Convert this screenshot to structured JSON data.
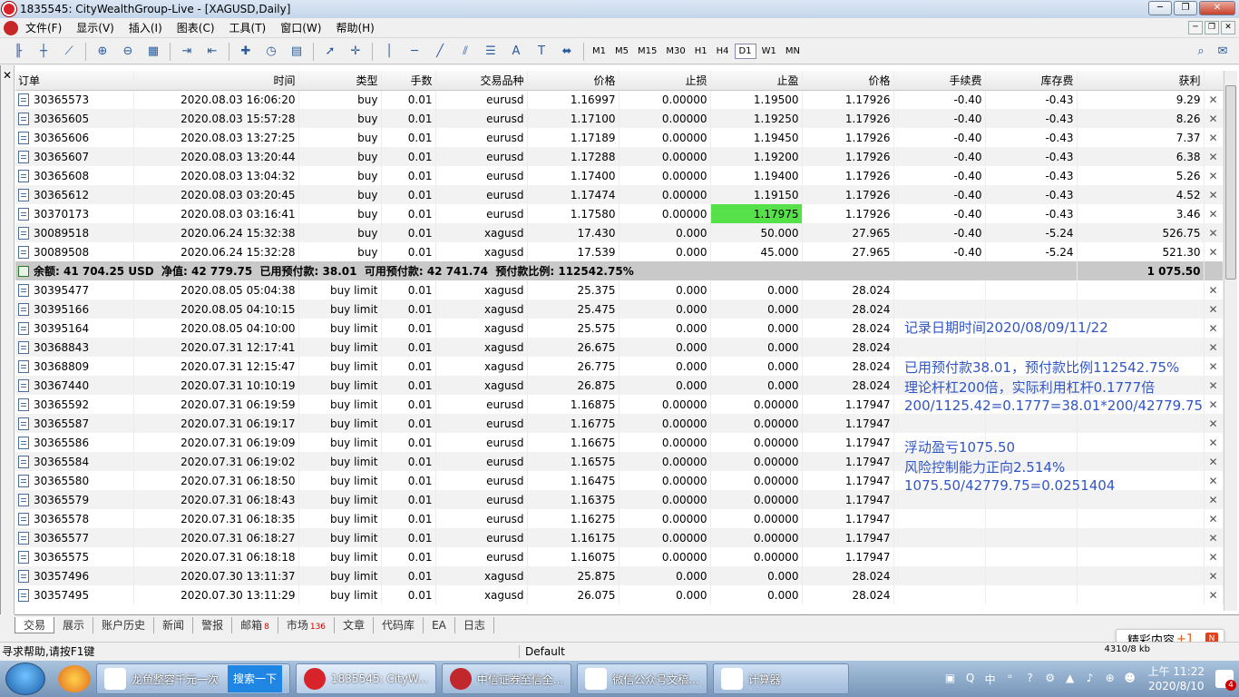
{
  "window": {
    "title": "1835545: CityWealthGroup-Live - [XAGUSD,Daily]"
  },
  "menu": [
    "文件(F)",
    "显示(V)",
    "插入(I)",
    "图表(C)",
    "工具(T)",
    "窗口(W)",
    "帮助(H)"
  ],
  "toolbar": {
    "timeframes": [
      "M1",
      "M5",
      "M15",
      "M30",
      "H1",
      "H4",
      "D1",
      "W1",
      "MN"
    ],
    "active_timeframe": "D1"
  },
  "columns": [
    "订单",
    "时间",
    "类型",
    "手数",
    "交易品种",
    "价格",
    "止损",
    "止盈",
    "价格",
    "手续费",
    "库存费",
    "获利"
  ],
  "positions": [
    {
      "order": "30365573",
      "time": "2020.08.03 16:06:20",
      "type": "buy",
      "lots": "0.01",
      "symbol": "eurusd",
      "price": "1.16997",
      "sl": "0.00000",
      "tp": "1.19500",
      "cur": "1.17926",
      "commission": "-0.40",
      "swap": "-0.43",
      "profit": "9.29"
    },
    {
      "order": "30365605",
      "time": "2020.08.03 15:57:28",
      "type": "buy",
      "lots": "0.01",
      "symbol": "eurusd",
      "price": "1.17100",
      "sl": "0.00000",
      "tp": "1.19250",
      "cur": "1.17926",
      "commission": "-0.40",
      "swap": "-0.43",
      "profit": "8.26"
    },
    {
      "order": "30365606",
      "time": "2020.08.03 13:27:25",
      "type": "buy",
      "lots": "0.01",
      "symbol": "eurusd",
      "price": "1.17189",
      "sl": "0.00000",
      "tp": "1.19450",
      "cur": "1.17926",
      "commission": "-0.40",
      "swap": "-0.43",
      "profit": "7.37"
    },
    {
      "order": "30365607",
      "time": "2020.08.03 13:20:44",
      "type": "buy",
      "lots": "0.01",
      "symbol": "eurusd",
      "price": "1.17288",
      "sl": "0.00000",
      "tp": "1.19200",
      "cur": "1.17926",
      "commission": "-0.40",
      "swap": "-0.43",
      "profit": "6.38"
    },
    {
      "order": "30365608",
      "time": "2020.08.03 13:04:32",
      "type": "buy",
      "lots": "0.01",
      "symbol": "eurusd",
      "price": "1.17400",
      "sl": "0.00000",
      "tp": "1.19400",
      "cur": "1.17926",
      "commission": "-0.40",
      "swap": "-0.43",
      "profit": "5.26"
    },
    {
      "order": "30365612",
      "time": "2020.08.03 03:20:45",
      "type": "buy",
      "lots": "0.01",
      "symbol": "eurusd",
      "price": "1.17474",
      "sl": "0.00000",
      "tp": "1.19150",
      "cur": "1.17926",
      "commission": "-0.40",
      "swap": "-0.43",
      "profit": "4.52"
    },
    {
      "order": "30370173",
      "time": "2020.08.03 03:16:41",
      "type": "buy",
      "lots": "0.01",
      "symbol": "eurusd",
      "price": "1.17580",
      "sl": "0.00000",
      "tp": "1.17975",
      "cur": "1.17926",
      "commission": "-0.40",
      "swap": "-0.43",
      "profit": "3.46",
      "tp_highlight": true
    },
    {
      "order": "30089518",
      "time": "2020.06.24 15:32:38",
      "type": "buy",
      "lots": "0.01",
      "symbol": "xagusd",
      "price": "17.430",
      "sl": "0.000",
      "tp": "50.000",
      "cur": "27.965",
      "commission": "-0.40",
      "swap": "-5.24",
      "profit": "526.75"
    },
    {
      "order": "30089508",
      "time": "2020.06.24 15:32:28",
      "type": "buy",
      "lots": "0.01",
      "symbol": "xagusd",
      "price": "17.539",
      "sl": "0.000",
      "tp": "45.000",
      "cur": "27.965",
      "commission": "-0.40",
      "swap": "-5.24",
      "profit": "521.30"
    }
  ],
  "summary": {
    "text": "余额: 41 704.25 USD  净值: 42 779.75  已用预付款: 38.01  可用预付款: 42 741.74  预付款比例: 112542.75%",
    "profit": "1 075.50"
  },
  "pending": [
    {
      "order": "30395477",
      "time": "2020.08.05 05:04:38",
      "type": "buy limit",
      "lots": "0.01",
      "symbol": "xagusd",
      "price": "25.375",
      "sl": "0.000",
      "tp": "0.000",
      "cur": "28.024"
    },
    {
      "order": "30395166",
      "time": "2020.08.05 04:10:15",
      "type": "buy limit",
      "lots": "0.01",
      "symbol": "xagusd",
      "price": "25.475",
      "sl": "0.000",
      "tp": "0.000",
      "cur": "28.024"
    },
    {
      "order": "30395164",
      "time": "2020.08.05 04:10:00",
      "type": "buy limit",
      "lots": "0.01",
      "symbol": "xagusd",
      "price": "25.575",
      "sl": "0.000",
      "tp": "0.000",
      "cur": "28.024"
    },
    {
      "order": "30368843",
      "time": "2020.07.31 12:17:41",
      "type": "buy limit",
      "lots": "0.01",
      "symbol": "xagusd",
      "price": "26.675",
      "sl": "0.000",
      "tp": "0.000",
      "cur": "28.024"
    },
    {
      "order": "30368809",
      "time": "2020.07.31 12:15:47",
      "type": "buy limit",
      "lots": "0.01",
      "symbol": "xagusd",
      "price": "26.775",
      "sl": "0.000",
      "tp": "0.000",
      "cur": "28.024"
    },
    {
      "order": "30367440",
      "time": "2020.07.31 10:10:19",
      "type": "buy limit",
      "lots": "0.01",
      "symbol": "xagusd",
      "price": "26.875",
      "sl": "0.000",
      "tp": "0.000",
      "cur": "28.024"
    },
    {
      "order": "30365592",
      "time": "2020.07.31 06:19:59",
      "type": "buy limit",
      "lots": "0.01",
      "symbol": "eurusd",
      "price": "1.16875",
      "sl": "0.00000",
      "tp": "0.00000",
      "cur": "1.17947"
    },
    {
      "order": "30365587",
      "time": "2020.07.31 06:19:17",
      "type": "buy limit",
      "lots": "0.01",
      "symbol": "eurusd",
      "price": "1.16775",
      "sl": "0.00000",
      "tp": "0.00000",
      "cur": "1.17947"
    },
    {
      "order": "30365586",
      "time": "2020.07.31 06:19:09",
      "type": "buy limit",
      "lots": "0.01",
      "symbol": "eurusd",
      "price": "1.16675",
      "sl": "0.00000",
      "tp": "0.00000",
      "cur": "1.17947"
    },
    {
      "order": "30365584",
      "time": "2020.07.31 06:19:02",
      "type": "buy limit",
      "lots": "0.01",
      "symbol": "eurusd",
      "price": "1.16575",
      "sl": "0.00000",
      "tp": "0.00000",
      "cur": "1.17947"
    },
    {
      "order": "30365580",
      "time": "2020.07.31 06:18:50",
      "type": "buy limit",
      "lots": "0.01",
      "symbol": "eurusd",
      "price": "1.16475",
      "sl": "0.00000",
      "tp": "0.00000",
      "cur": "1.17947"
    },
    {
      "order": "30365579",
      "time": "2020.07.31 06:18:43",
      "type": "buy limit",
      "lots": "0.01",
      "symbol": "eurusd",
      "price": "1.16375",
      "sl": "0.00000",
      "tp": "0.00000",
      "cur": "1.17947"
    },
    {
      "order": "30365578",
      "time": "2020.07.31 06:18:35",
      "type": "buy limit",
      "lots": "0.01",
      "symbol": "eurusd",
      "price": "1.16275",
      "sl": "0.00000",
      "tp": "0.00000",
      "cur": "1.17947"
    },
    {
      "order": "30365577",
      "time": "2020.07.31 06:18:27",
      "type": "buy limit",
      "lots": "0.01",
      "symbol": "eurusd",
      "price": "1.16175",
      "sl": "0.00000",
      "tp": "0.00000",
      "cur": "1.17947"
    },
    {
      "order": "30365575",
      "time": "2020.07.31 06:18:18",
      "type": "buy limit",
      "lots": "0.01",
      "symbol": "eurusd",
      "price": "1.16075",
      "sl": "0.00000",
      "tp": "0.00000",
      "cur": "1.17947"
    },
    {
      "order": "30357496",
      "time": "2020.07.30 13:11:37",
      "type": "buy limit",
      "lots": "0.01",
      "symbol": "xagusd",
      "price": "25.875",
      "sl": "0.000",
      "tp": "0.000",
      "cur": "28.024"
    },
    {
      "order": "30357495",
      "time": "2020.07.30 13:11:29",
      "type": "buy limit",
      "lots": "0.01",
      "symbol": "xagusd",
      "price": "26.075",
      "sl": "0.000",
      "tp": "0.000",
      "cur": "28.024"
    }
  ],
  "annotations": [
    "记录日期时间2020/08/09/11/22",
    "已用预付款38.01，预付款比例112542.75%",
    "理论杆杠200倍，实际利用杠杆0.1777倍",
    "200/1125.42=0.1777=38.01*200/42779.75",
    "浮动盈亏1075.50",
    "风险控制能力正向2.514%",
    "1075.50/42779.75=0.0251404"
  ],
  "tabs": [
    {
      "label": "交易",
      "active": true
    },
    {
      "label": "展示"
    },
    {
      "label": "账户历史"
    },
    {
      "label": "新闻"
    },
    {
      "label": "警报"
    },
    {
      "label": "邮箱",
      "badge": "8"
    },
    {
      "label": "市场",
      "badge": "136"
    },
    {
      "label": "文章"
    },
    {
      "label": "代码库"
    },
    {
      "label": "EA"
    },
    {
      "label": "日志"
    }
  ],
  "status": {
    "help": "寻求帮助,请按F1键",
    "profile": "Default",
    "traffic": "4310/8 kb"
  },
  "popup": {
    "label": "精彩内容",
    "plus": "+1",
    "icon_letter": "N"
  },
  "taskbar": {
    "items": [
      {
        "label": "龙鱼整容千元一次"
      },
      {
        "label": "1835545: CityW..."
      },
      {
        "label": "中信证券至信全..."
      },
      {
        "label": "微信公众号文稿..."
      },
      {
        "label": "计算器"
      }
    ],
    "search_label": "搜索一下",
    "clock_time": "上午 11:22",
    "clock_date": "2020/8/10",
    "ime": "中",
    "notification_count": "4"
  },
  "colors": {
    "tp_highlight": "#56e04a",
    "annotation": "#3155c4",
    "summary_bg": "#c9c9c9"
  }
}
